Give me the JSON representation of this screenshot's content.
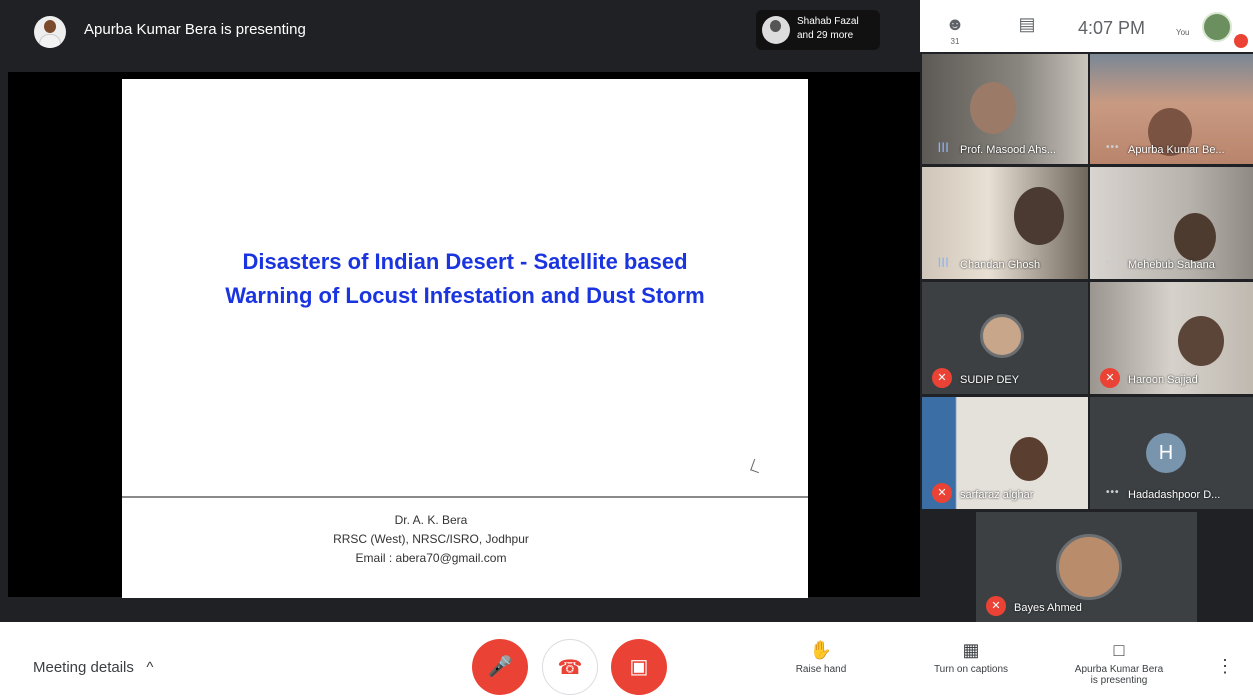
{
  "header": {
    "presenting_text": "Apurba Kumar Bera is presenting",
    "participants_chip_line1": "Shahab Fazal",
    "participants_chip_line2": "and 29 more"
  },
  "topright": {
    "people_count": "31",
    "time": "4:07 PM",
    "you_label": "You"
  },
  "slide": {
    "title_line1": "Disasters of Indian Desert  - Satellite based",
    "title_line2": "Warning of Locust Infestation and Dust Storm",
    "author": "Dr. A. K. Bera",
    "affiliation": "RRSC (West), NRSC/ISRO, Jodhpur",
    "email": "Email : abera70@gmail.com"
  },
  "tiles": [
    {
      "name": "Prof. Masood Ahs..."
    },
    {
      "name": "Apurba Kumar Be..."
    },
    {
      "name": "Chandan Ghosh"
    },
    {
      "name": "Mehebub Sahana"
    },
    {
      "name": "SUDIP DEY"
    },
    {
      "name": "Haroon Sajjad"
    },
    {
      "name": "sarfaraz alghar"
    },
    {
      "name": "Hadadashpoor D..."
    },
    {
      "name": "Bayes Ahmed"
    }
  ],
  "avatar_letter": "H",
  "footer": {
    "meeting_details": "Meeting details",
    "raise_hand": "Raise hand",
    "captions": "Turn on captions",
    "presenting_line1": "Apurba Kumar Bera",
    "presenting_line2": "is presenting"
  },
  "colors": {
    "slide_title": "#1a35e0",
    "danger": "#ea4335",
    "speaking": "#8ab4f8"
  },
  "icons": [
    "people-icon",
    "chat-icon",
    "mic-off-icon",
    "hangup-icon",
    "camera-off-icon",
    "raise-hand-icon",
    "captions-icon",
    "present-icon",
    "more-vert-icon"
  ]
}
